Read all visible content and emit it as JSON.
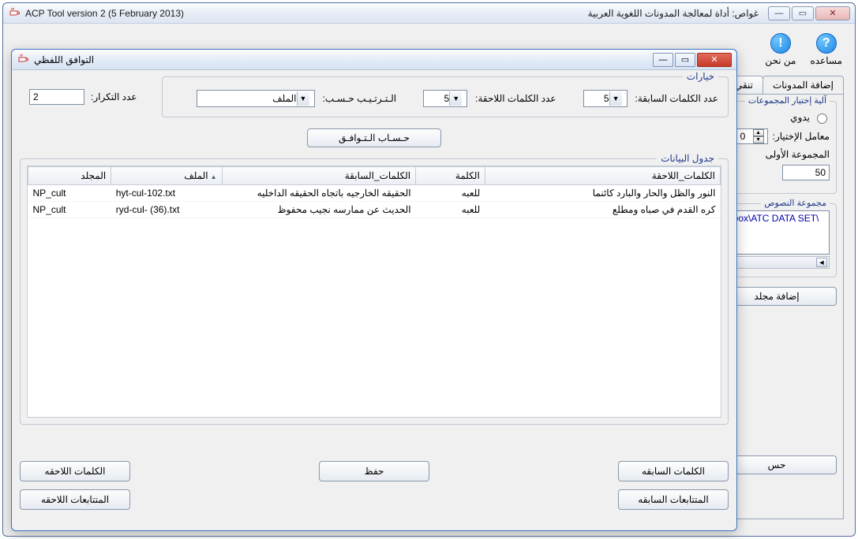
{
  "main_window": {
    "title_left": "ACP Tool version 2 (5 February 2013)",
    "title_right": "غواص: أداة لمعالجة المدونات اللغوية العربية",
    "icon_buttons": {
      "help": "مساعده",
      "about": "من نحن"
    },
    "tabs": {
      "add_corpora": "إضافة المدونات",
      "refine": "تنقي"
    },
    "groups_fieldset": {
      "legend": "آلية إختيار المجموعات",
      "manual": "يدوي",
      "coeff_label": "معامل الإختيار:",
      "coeff_value": "0",
      "first_group_label": "المجموعة الأولى",
      "first_group_value": "50"
    },
    "texts_fieldset": {
      "legend": "مجموعة النصوص",
      "path_fragment": "pbox\\ATC DATA SET\\"
    },
    "add_folder_btn": "إضافة مجلد",
    "compute_btn_fragment": "حس"
  },
  "dialog": {
    "title": "التوافق اللفظي",
    "options": {
      "legend": "خيارات",
      "prev_words_label": "عدد الكلمات السابقة:",
      "prev_words_value": "5",
      "next_words_label": "عدد الكلمات اللاحقة:",
      "next_words_value": "5",
      "sort_label": "الـتـرتـيـب حـسـب:",
      "sort_value": "الملف",
      "repeat_label": "عدد التكرار:",
      "repeat_value": "2",
      "calc_button": "حـسـاب الـتـوافـق"
    },
    "table": {
      "legend": "جدول البيانات",
      "columns": {
        "folder": "المجلد",
        "file": "الملف",
        "prev_words": "الكلمات_السابقة",
        "word": "الكلمة",
        "next_words": "الكلمات_اللاحقة"
      },
      "rows": [
        {
          "folder": "NP_cult",
          "file": "hyt-cul-102.txt",
          "prev": "الحقيقه الخارجيه باتجاه الحقيقه الداخليه",
          "word": "للعبه",
          "next": "النور والظل والحار والبارد كائنما"
        },
        {
          "folder": "NP_cult",
          "file": "ryd-cul- (36).txt",
          "prev": "الحديث عن ممارسه نجيب محفوظ",
          "word": "للعبه",
          "next": "كره القدم في صباه ومطلع"
        }
      ]
    },
    "buttons": {
      "prev_words": "الكلمات السابقه",
      "next_words": "الكلمات اللاحقه",
      "save": "حفظ",
      "prev_colloc": "المتتابعات السابقه",
      "next_colloc": "المتتابعات اللاحقه"
    }
  }
}
